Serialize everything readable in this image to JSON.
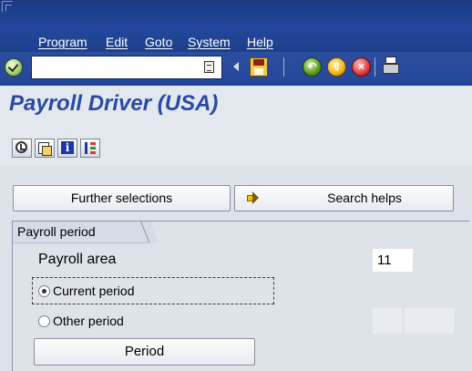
{
  "window": {
    "menu": [
      "Program",
      "Edit",
      "Goto",
      "System",
      "Help"
    ]
  },
  "toolbar": {
    "command_field_value": ""
  },
  "title": "Payroll Driver (USA)",
  "selection": {
    "further_selections_label": "Further selections",
    "search_helps_label": "Search helps"
  },
  "payroll_period": {
    "frame_title": "Payroll period",
    "payroll_area_label": "Payroll area",
    "payroll_area_value": "11",
    "current_period_label": "Current period",
    "current_period_selected": true,
    "other_period_label": "Other period",
    "other_period_selected": false,
    "period_from": "",
    "period_to": "",
    "period_button_label": "Period"
  },
  "colors": {
    "menubar": "#22489b",
    "title_text": "#2b4aa3",
    "background": "#dee3ea"
  },
  "icons": {
    "toolbar": [
      "enter-icon",
      "command-field-toggle-icon",
      "save-icon",
      "back-icon",
      "exit-icon",
      "cancel-icon",
      "print-icon"
    ],
    "app_toolbar": [
      "execute-clock-icon",
      "get-variant-icon",
      "program-documentation-icon",
      "layout-icon"
    ]
  }
}
